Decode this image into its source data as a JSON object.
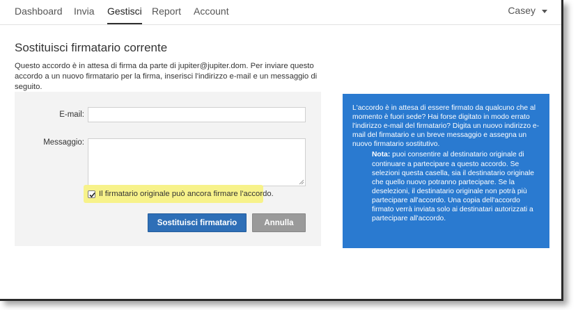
{
  "nav": {
    "items": [
      {
        "label": "Dashboard"
      },
      {
        "label": "Invia"
      },
      {
        "label": "Gestisci"
      },
      {
        "label": "Report"
      },
      {
        "label": "Account"
      }
    ],
    "active_index": 2,
    "user_name": "Casey"
  },
  "page": {
    "title": "Sostituisci firmatario corrente",
    "intro": "Questo accordo è in attesa di firma da parte di jupiter@jupiter.dom. Per inviare questo accordo a un nuovo firmatario per la firma, inserisci l'indirizzo e-mail e un messaggio di seguito."
  },
  "form": {
    "email_label": "E-mail:",
    "email_value": "",
    "message_label": "Messaggio:",
    "message_value": "",
    "checkbox_label": "Il firmatario originale può ancora firmare l'accordo.",
    "checkbox_checked": true,
    "submit_label": "Sostituisci firmatario",
    "cancel_label": "Annulla"
  },
  "info": {
    "text": "L'accordo è in attesa di essere firmato da qualcuno che al momento è fuori sede? Hai forse digitato in modo errato l'indirizzo e-mail del firmatario? Digita un nuovo indirizzo e-mail del firmatario e un breve messaggio e assegna un nuovo firmatario sostitutivo.",
    "note_prefix": "Nota:",
    "note_text": " puoi consentire al destinatario originale di continuare a partecipare a questo accordo. Se selezioni questa casella, sia il destinatario originale che quello nuovo potranno partecipare. Se la deselezioni, il destinatario originale non potrà più partecipare all'accordo. Una copia dell'accordo firmato verrà inviata solo ai destinatari autorizzati a partecipare all'accordo."
  },
  "colors": {
    "primary_button": "#2e6fb7",
    "info_panel": "#2a7ad0",
    "highlight": "#f7f28a"
  }
}
